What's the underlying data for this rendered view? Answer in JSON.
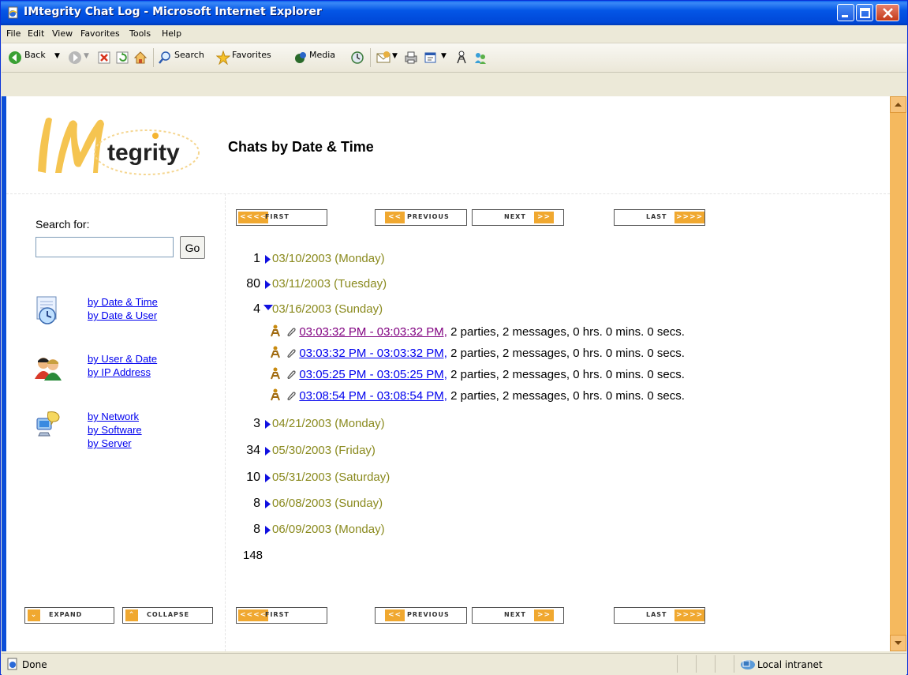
{
  "window": {
    "title": "IMtegrity Chat Log - Microsoft Internet Explorer"
  },
  "menu": [
    "File",
    "Edit",
    "View",
    "Favorites",
    "Tools",
    "Help"
  ],
  "toolbar": {
    "back": "Back",
    "search": "Search",
    "favorites": "Favorites",
    "media": "Media"
  },
  "status": {
    "text": "Done",
    "zone": "Local intranet"
  },
  "page": {
    "logo_text": "tegrity",
    "title": "Chats by Date & Time",
    "search": {
      "label": "Search for:",
      "value": "",
      "go": "Go"
    },
    "nav": {
      "group1": [
        "by Date & Time",
        "by Date & User"
      ],
      "group2": [
        "by User & Date",
        "by IP Address"
      ],
      "group3": [
        "by Network",
        "by Software",
        "by Server"
      ]
    },
    "pager": {
      "first": "FIRST",
      "previous": "PREVIOUS",
      "next": "NEXT",
      "last": "LAST",
      "first_arrows": "<<<<",
      "prev_arrows": "<<",
      "next_arrows": ">>",
      "last_arrows": ">>>>"
    },
    "controls": {
      "expand": "EXPAND",
      "collapse": "COLLAPSE"
    },
    "dates": [
      {
        "count": "1",
        "label": "03/10/2003 (Monday)",
        "expanded": false
      },
      {
        "count": "80",
        "label": "03/11/2003 (Tuesday)",
        "expanded": false
      },
      {
        "count": "4",
        "label": "03/16/2003 (Sunday)",
        "expanded": true
      },
      {
        "count": "3",
        "label": "04/21/2003 (Monday)",
        "expanded": false
      },
      {
        "count": "34",
        "label": "05/30/2003 (Friday)",
        "expanded": false
      },
      {
        "count": "10",
        "label": "05/31/2003 (Saturday)",
        "expanded": false
      },
      {
        "count": "8",
        "label": "06/08/2003 (Sunday)",
        "expanded": false
      },
      {
        "count": "8",
        "label": "06/09/2003 (Monday)",
        "expanded": false
      }
    ],
    "chats": [
      {
        "time": "03:03:32 PM - 03:03:32 PM,",
        "details": "2 parties, 2 messages, 0 hrs. 0 mins. 0 secs.",
        "visited": true
      },
      {
        "time": "03:03:32 PM - 03:03:32 PM,",
        "details": "2 parties, 2 messages, 0 hrs. 0 mins. 0 secs.",
        "visited": false
      },
      {
        "time": "03:05:25 PM - 03:05:25 PM,",
        "details": "2 parties, 2 messages, 0 hrs. 0 mins. 0 secs.",
        "visited": false
      },
      {
        "time": "03:08:54 PM - 03:08:54 PM,",
        "details": "2 parties, 2 messages, 0 hrs. 0 mins. 0 secs.",
        "visited": false
      }
    ],
    "total": "148"
  }
}
